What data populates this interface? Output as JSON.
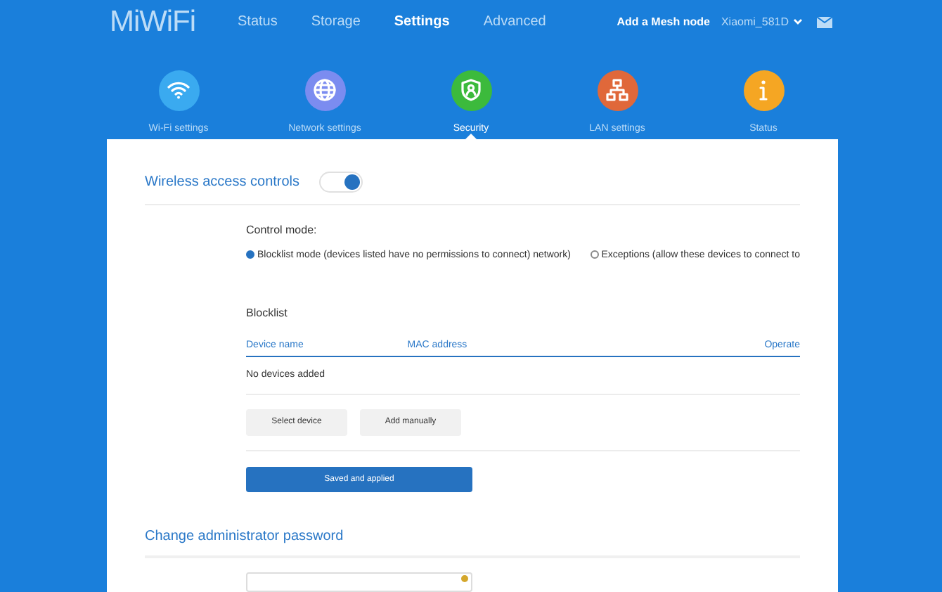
{
  "header": {
    "logo": "MiWiFi",
    "nav": [
      {
        "label": "Status",
        "selected": false
      },
      {
        "label": "Storage",
        "selected": false
      },
      {
        "label": "Settings",
        "selected": true
      },
      {
        "label": "Advanced",
        "selected": false
      }
    ],
    "mesh_link": "Add a Mesh node",
    "router_name": "Xiaomi_581D"
  },
  "categories": [
    {
      "kind": "wifi",
      "label": "Wi-Fi settings",
      "color": "#3aaaf0",
      "selected": false
    },
    {
      "kind": "globe",
      "label": "Network settings",
      "color": "#7b8cf0",
      "selected": false
    },
    {
      "kind": "shield",
      "label": "Security",
      "color": "#3cba3c",
      "selected": true
    },
    {
      "kind": "lan",
      "label": "LAN settings",
      "color": "#e0683a",
      "selected": false
    },
    {
      "kind": "info",
      "label": "Status",
      "color": "#f5a623",
      "selected": false
    }
  ],
  "wireless_access": {
    "title": "Wireless access controls",
    "on": true,
    "control_mode_label": "Control mode:",
    "modes": [
      {
        "label": "Blocklist mode (devices listed have no permissions to connect) network)",
        "selected": true
      },
      {
        "label": "Exceptions (allow these devices to connect to",
        "selected": false
      }
    ],
    "blocklist": {
      "title": "Blocklist",
      "columns": [
        "Device name",
        "MAC address",
        "Operate"
      ],
      "empty_text": "No devices added"
    },
    "buttons": [
      "Select device",
      "Add manually"
    ],
    "save_button": "Saved and applied"
  },
  "password_section": {
    "title": "Change administrator password"
  }
}
